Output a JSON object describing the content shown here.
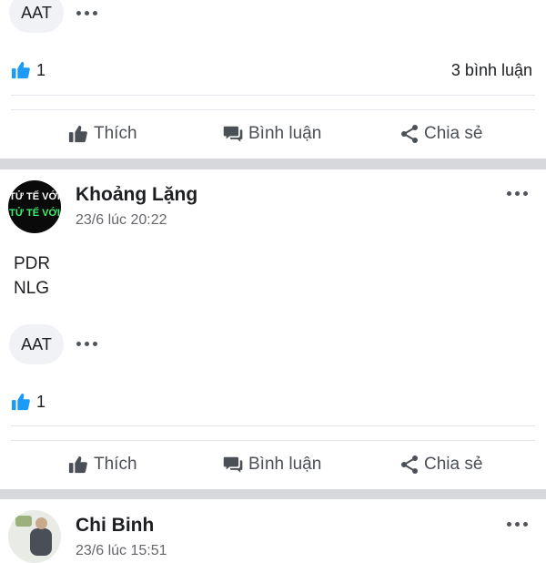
{
  "post_top": {
    "reaction_chip": "AAT",
    "like_count": "1",
    "comment_count": "3 bình luận",
    "actions": {
      "like": "Thích",
      "comment": "Bình luận",
      "share": "Chia sẻ"
    }
  },
  "post_middle": {
    "author": "Khoảng Lặng",
    "timestamp": "23/6 lúc 20:22",
    "avatar_text_1": "TỬ TẾ VỚI",
    "avatar_text_2": "TỬ TẾ VỚI",
    "body_lines": [
      "PDR",
      "NLG"
    ],
    "reaction_chip": "AAT",
    "like_count": "1",
    "actions": {
      "like": "Thích",
      "comment": "Bình luận",
      "share": "Chia sẻ"
    }
  },
  "post_bottom": {
    "author": "Chi Binh",
    "timestamp_partial": "23/6 lúc 15:51"
  },
  "colors": {
    "like_blue": "#1b9af7",
    "separator_band": "#d6d8dc",
    "icon_gray": "#4b4f56"
  },
  "icons": [
    "like-thumb-icon",
    "comment-bubble-icon",
    "share-icon",
    "more-options-icon"
  ]
}
